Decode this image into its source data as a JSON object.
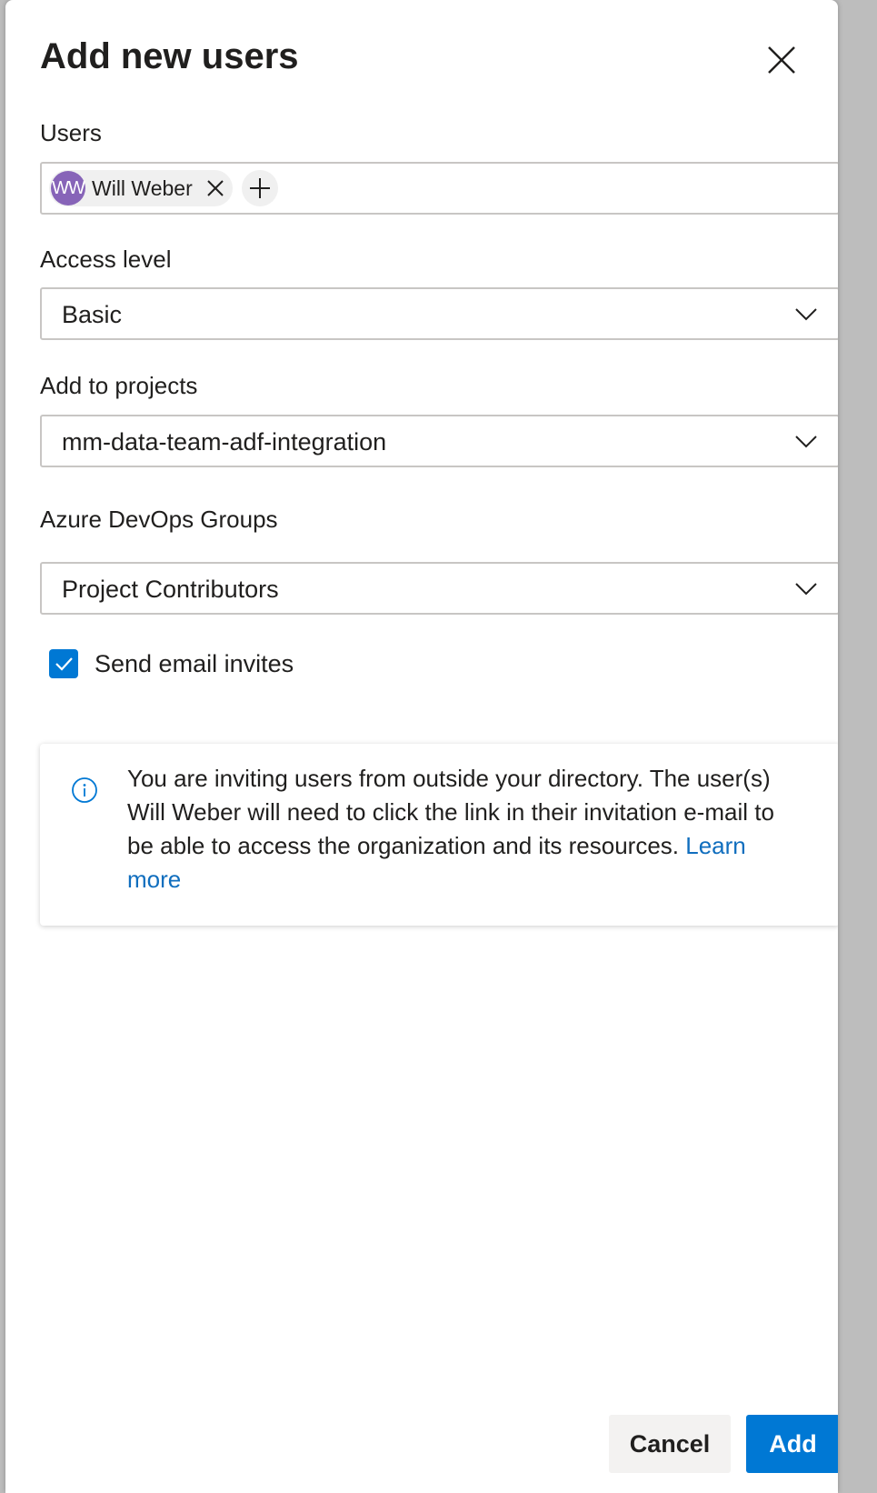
{
  "dialog": {
    "title": "Add new users"
  },
  "users": {
    "label": "Users",
    "chips": [
      {
        "initials": "WW",
        "name": "Will Weber"
      }
    ]
  },
  "access_level": {
    "label": "Access level",
    "value": "Basic"
  },
  "projects": {
    "label": "Add to projects",
    "value": "mm-data-team-adf-integration"
  },
  "groups": {
    "label": "Azure DevOps Groups",
    "value": "Project Contributors"
  },
  "email_invites": {
    "label": "Send email invites",
    "checked": true
  },
  "info": {
    "message": "You are inviting users from outside your directory. The user(s) Will Weber will need to click the link in their invitation e-mail to be able to access the organization and its resources.",
    "link_text": "Learn more"
  },
  "footer": {
    "cancel_label": "Cancel",
    "add_label": "Add"
  },
  "colors": {
    "accent": "#0078d4",
    "avatar": "#8764b8",
    "link": "#106ebe"
  }
}
